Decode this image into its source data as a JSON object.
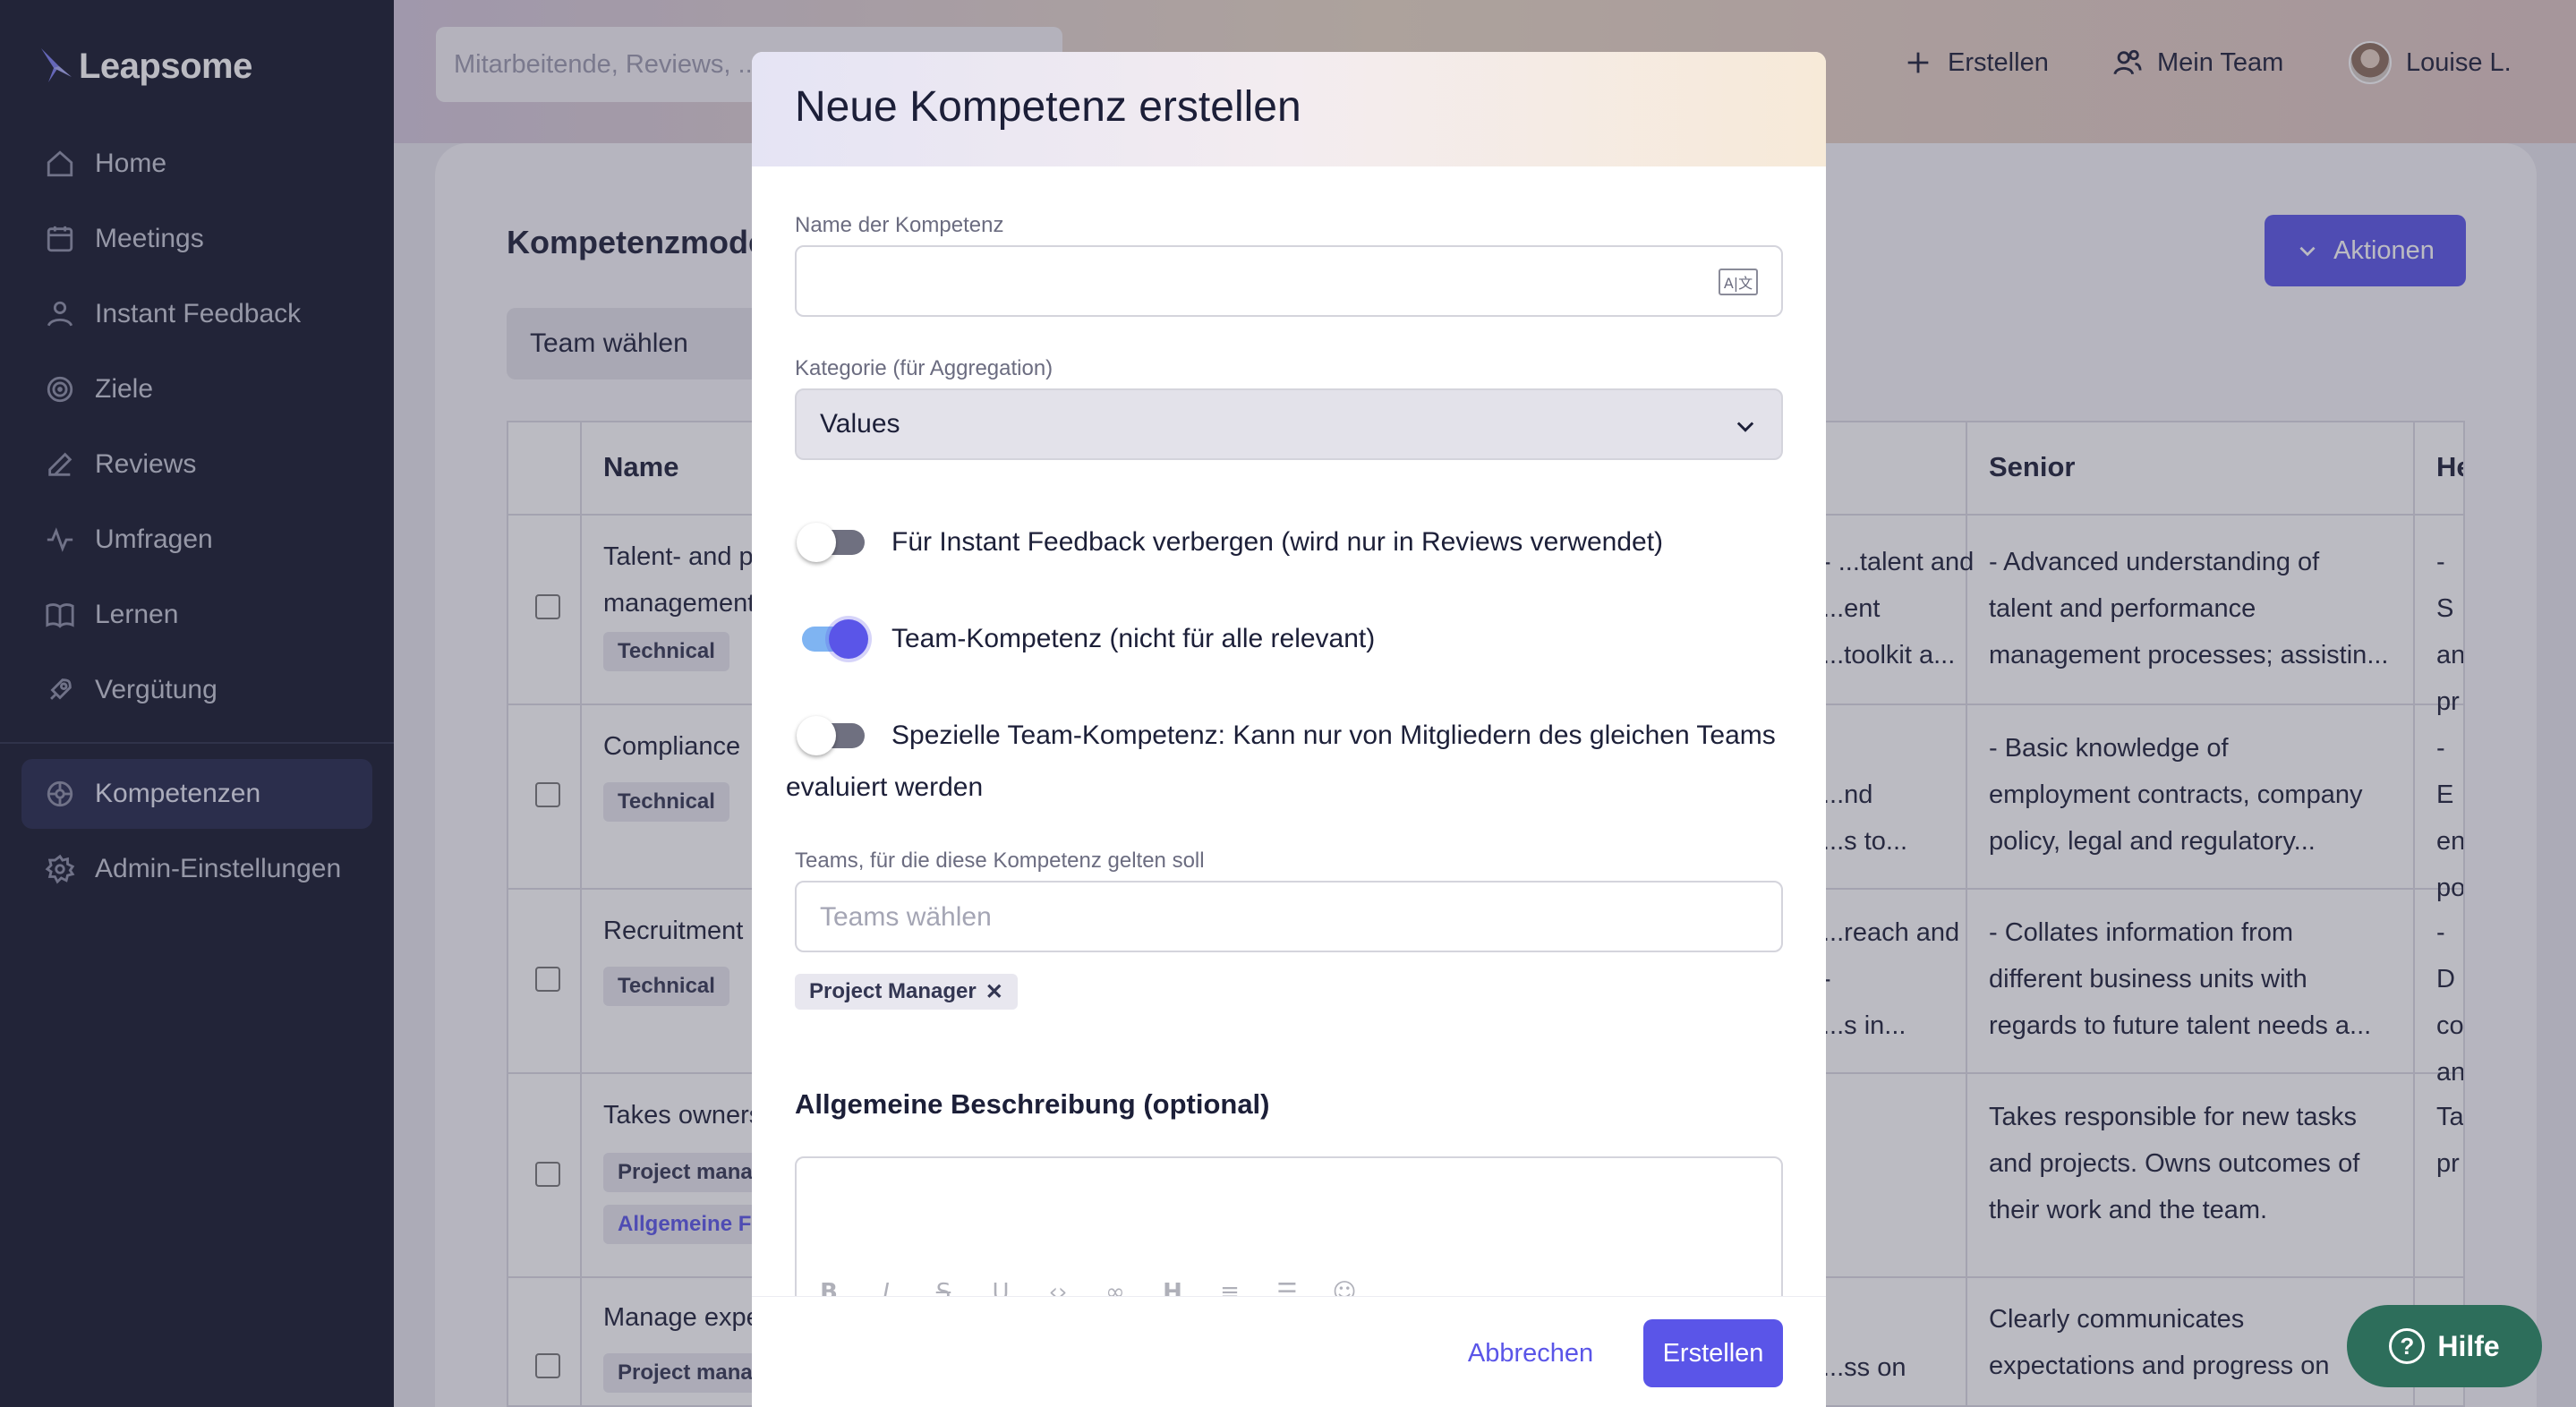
{
  "app": {
    "name": "Leapsome"
  },
  "sidebar": {
    "items": [
      {
        "label": "Home",
        "icon": "home-icon"
      },
      {
        "label": "Meetings",
        "icon": "meetings-icon"
      },
      {
        "label": "Instant Feedback",
        "icon": "feedback-icon"
      },
      {
        "label": "Ziele",
        "icon": "target-icon"
      },
      {
        "label": "Reviews",
        "icon": "edit-icon"
      },
      {
        "label": "Umfragen",
        "icon": "pulse-icon"
      },
      {
        "label": "Lernen",
        "icon": "book-icon"
      },
      {
        "label": "Vergütung",
        "icon": "rocket-icon"
      },
      {
        "label": "Kompetenzen",
        "icon": "competency-icon",
        "active": true
      },
      {
        "label": "Admin-Einstellungen",
        "icon": "gear-icon"
      }
    ]
  },
  "topbar": {
    "search_placeholder": "Mitarbeitende, Reviews, ...",
    "create_label": "Erstellen",
    "team_label": "Mein Team",
    "user_name": "Louise L."
  },
  "page": {
    "title": "Kompetenzmodelle",
    "team_select": "Team wählen",
    "actions_label": "Aktionen",
    "table": {
      "headers": {
        "name": "Name",
        "senior": "Senior",
        "head": "Head"
      },
      "rows": [
        {
          "name": "Talent- and performance management",
          "tags": [
            "Technical"
          ],
          "partial": "- ...talent and\n...ent\n...toolkit a...",
          "senior": "- Advanced understanding of\ntalent and performance\nmanagement processes; assistin...",
          "head": "- S\nan\npr"
        },
        {
          "name": "Compliance",
          "tags": [
            "Technical"
          ],
          "partial": "...nd\n...s to...",
          "senior": "- Basic knowledge of\nemployment contracts, company\npolicy, legal and regulatory...",
          "head": "- E\nen\npo"
        },
        {
          "name": "Recruitment",
          "tags": [
            "Technical"
          ],
          "partial": "...reach and\n-\n...s in...",
          "senior": "- Collates information from\ndifferent business units with\nregards to future talent needs a...",
          "head": "- D\nco\nan"
        },
        {
          "name": "Takes ownership",
          "tags": [
            "Project manager",
            "Allgemeine Fä..."
          ],
          "partial": "",
          "senior": "Takes responsible for new tasks\nand projects. Owns outcomes of\ntheir work and the team.",
          "head": "Ta\npr"
        },
        {
          "name": "Manage expectations",
          "tags": [
            "Project manager"
          ],
          "partial": "...ss on",
          "senior": "Clearly communicates\nexpectations and progress on",
          "head": ""
        }
      ]
    }
  },
  "modal": {
    "title": "Neue Kompetenz erstellen",
    "name_label": "Name der Kompetenz",
    "name_value": "",
    "category_label": "Kategorie (für Aggregation)",
    "category_value": "Values",
    "toggle_hide_if": {
      "label": "Für Instant Feedback verbergen (wird nur in Reviews verwendet)",
      "on": false
    },
    "toggle_team": {
      "label": "Team-Kompetenz (nicht für alle relevant)",
      "on": true
    },
    "toggle_special_line1": "Spezielle Team-Kompetenz: Kann nur von Mitgliedern des gleichen Teams",
    "toggle_special_line2": "evaluiert werden",
    "teams_label": "Teams, für die diese Kompetenz gelten soll",
    "teams_placeholder": "Teams wählen",
    "selected_team": "Project Manager",
    "description_title": "Allgemeine Beschreibung (optional)",
    "cancel_label": "Abbrechen",
    "create_label": "Erstellen"
  },
  "help": {
    "label": "Hilfe"
  },
  "colors": {
    "accent": "#5a55e8",
    "sidebar": "#14172b",
    "help": "#2d6e5b"
  }
}
